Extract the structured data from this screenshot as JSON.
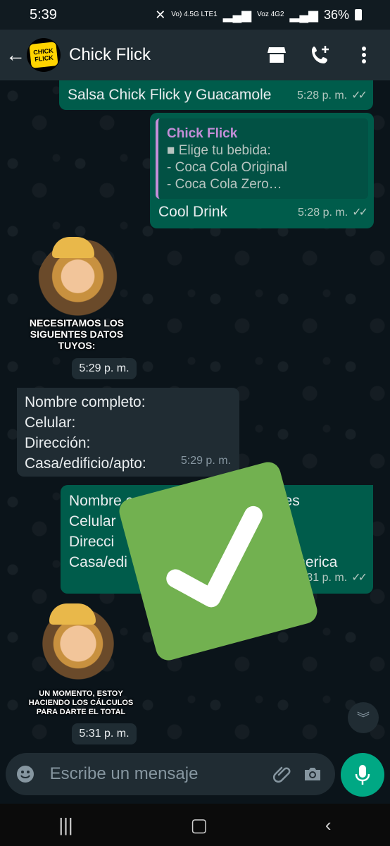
{
  "status_bar": {
    "time": "5:39",
    "signal1": "Vo) 4.5G LTE1",
    "signal2": "Voz 4G2",
    "battery": "36%"
  },
  "header": {
    "contact_name": "Chick Flick",
    "avatar_text": "CHICK FLICK"
  },
  "messages": [
    {
      "text": "Salsa Chick Flick y Guacamole",
      "time": "5:28 p. m."
    },
    {
      "quote_author": "Chick Flick",
      "quote_lines": [
        "■ Elige tu bebida:",
        "- Coca Cola Original",
        "- Coca Cola Zero…"
      ],
      "text": "Cool Drink",
      "time": "5:28 p. m."
    },
    {
      "sticker_caption": "NECESITAMOS LOS SIGUENTES DATOS TUYOS:",
      "time": "5:29 p. m."
    },
    {
      "lines": [
        "Nombre completo:",
        "Celular:",
        "Dirección:",
        "Casa/edificio/apto:"
      ],
      "time": "5:29 p. m."
    },
    {
      "lines": [
        "Nombre com",
        "Celular",
        "Direcci",
        "Casa/edi"
      ],
      "lines_right": [
        "ntes",
        "",
        "95",
        "uramerica"
      ],
      "time": "31 p. m."
    },
    {
      "sticker_caption": "UN MOMENTO, ESTOY HACIENDO LOS CÁLCULOS PARA DARTE EL TOTAL",
      "time": "5:31 p. m."
    }
  ],
  "composer": {
    "placeholder": "Escribe un mensaje"
  },
  "colors": {
    "outgoing_bubble": "#005c4b",
    "incoming_bubble": "#202c33",
    "accent": "#00a884",
    "check_overlay": "#72b150",
    "quote_author": "#c38ed8"
  },
  "icons": [
    "back-arrow-icon",
    "store-icon",
    "add-call-icon",
    "more-icon",
    "emoji-icon",
    "attach-icon",
    "camera-icon",
    "mic-icon",
    "chevron-down-icon",
    "recents-icon",
    "home-icon",
    "back-nav-icon",
    "checkmark-icon"
  ]
}
